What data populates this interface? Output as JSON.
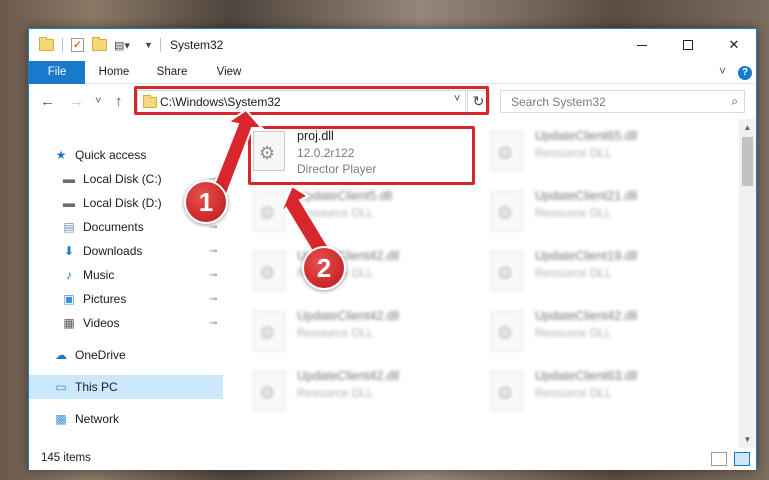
{
  "window": {
    "title": "System32",
    "min_symbol": "",
    "close_symbol": "✕"
  },
  "ribbon": {
    "tabs": [
      "File",
      "Home",
      "Share",
      "View"
    ],
    "collapse_symbol": "˅",
    "help_symbol": "?"
  },
  "nav": {
    "back_symbol": "←",
    "forward_symbol": "→",
    "recent_symbol": "˅",
    "up_symbol": "↑",
    "address": "C:\\Windows\\System32",
    "address_chevron": "˅",
    "refresh_symbol": "↻",
    "search_placeholder": "Search System32",
    "search_symbol": "⌕"
  },
  "sidebar": {
    "items": [
      {
        "label": "Quick access",
        "icon": "star-icon",
        "glyph": "★",
        "color": "#1979ca",
        "pinned": false
      },
      {
        "label": "Local Disk (C:)",
        "icon": "drive-icon",
        "glyph": "▬",
        "color": "#6b6b6b",
        "pinned": true
      },
      {
        "label": "Local Disk (D:)",
        "icon": "drive-icon",
        "glyph": "▬",
        "color": "#6b6b6b",
        "pinned": true
      },
      {
        "label": "Documents",
        "icon": "document-icon",
        "glyph": "▤",
        "color": "#6e8fb5",
        "pinned": true
      },
      {
        "label": "Downloads",
        "icon": "download-icon",
        "glyph": "⬇",
        "color": "#1979ca",
        "pinned": true
      },
      {
        "label": "Music",
        "icon": "music-icon",
        "glyph": "♪",
        "color": "#1979ca",
        "pinned": true
      },
      {
        "label": "Pictures",
        "icon": "pictures-icon",
        "glyph": "▣",
        "color": "#3a8fd8",
        "pinned": true
      },
      {
        "label": "Videos",
        "icon": "video-icon",
        "glyph": "▦",
        "color": "#555555",
        "pinned": true
      },
      {
        "label": "OneDrive",
        "icon": "cloud-icon",
        "glyph": "☁",
        "color": "#1979ca",
        "pinned": false
      },
      {
        "label": "This PC",
        "icon": "computer-icon",
        "glyph": "▭",
        "color": "#3a8fd8",
        "pinned": false,
        "selected": true
      },
      {
        "label": "Network",
        "icon": "network-icon",
        "glyph": "▩",
        "color": "#3a8fd8",
        "pinned": false
      }
    ],
    "pin_symbol": "📌"
  },
  "files": [
    {
      "name": "proj.dll",
      "version": "12.0.2r122",
      "desc": "Director Player",
      "clear": true
    },
    {
      "name": "UpdateClient65.dll",
      "desc": "Resource DLL",
      "clear": false
    },
    {
      "name": "UpdateClient5.dll",
      "desc": "Resource DLL",
      "clear": false
    },
    {
      "name": "UpdateClient21.dll",
      "desc": "Resource DLL",
      "clear": false
    },
    {
      "name": "UpdateClient42.dll",
      "desc": "Resource DLL",
      "clear": false
    },
    {
      "name": "UpdateClient19.dll",
      "desc": "Resource DLL",
      "clear": false
    },
    {
      "name": "UpdateClient42.dll",
      "desc": "Resource DLL",
      "clear": false
    },
    {
      "name": "UpdateClient42.dll",
      "desc": "Resource DLL",
      "clear": false
    },
    {
      "name": "UpdateClient42.dll",
      "desc": "Resource DLL",
      "clear": false
    },
    {
      "name": "UpdateClient63.dll",
      "desc": "Resource DLL",
      "clear": false
    }
  ],
  "status": {
    "item_count": "145 items"
  },
  "annotations": {
    "badge1": "1",
    "badge2": "2",
    "color": "#d9262c"
  }
}
